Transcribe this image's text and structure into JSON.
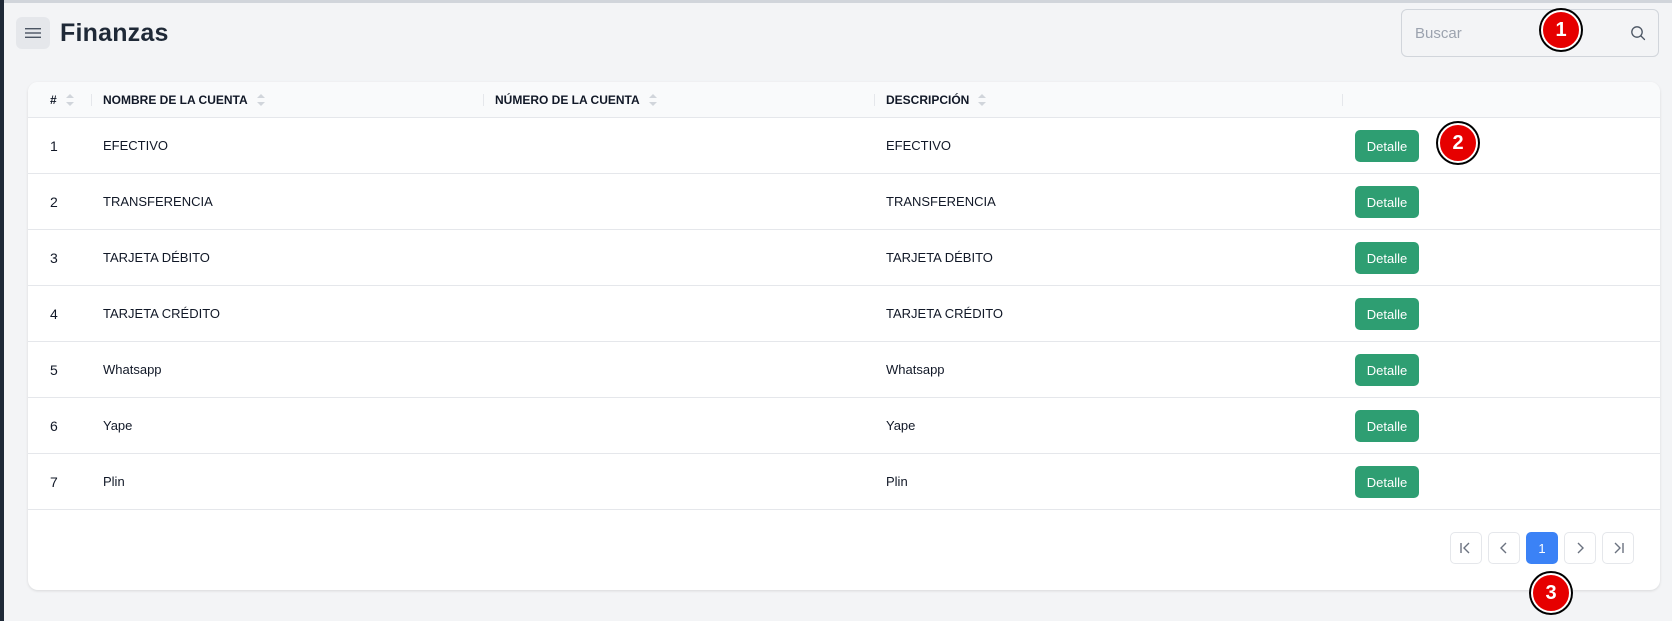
{
  "header": {
    "title": "Finanzas"
  },
  "search": {
    "placeholder": "Buscar"
  },
  "table": {
    "columns": [
      "#",
      "NOMBRE DE LA CUENTA",
      "NÚMERO DE LA CUENTA",
      "DESCRIPCIÓN"
    ],
    "rows": [
      {
        "index": "1",
        "name": "EFECTIVO",
        "number": "",
        "description": "EFECTIVO",
        "action": "Detalle"
      },
      {
        "index": "2",
        "name": "TRANSFERENCIA",
        "number": "",
        "description": "TRANSFERENCIA",
        "action": "Detalle"
      },
      {
        "index": "3",
        "name": "TARJETA DÉBITO",
        "number": "",
        "description": "TARJETA DÉBITO",
        "action": "Detalle"
      },
      {
        "index": "4",
        "name": "TARJETA CRÉDITO",
        "number": "",
        "description": "TARJETA CRÉDITO",
        "action": "Detalle"
      },
      {
        "index": "5",
        "name": "Whatsapp",
        "number": "",
        "description": "Whatsapp",
        "action": "Detalle"
      },
      {
        "index": "6",
        "name": "Yape",
        "number": "",
        "description": "Yape",
        "action": "Detalle"
      },
      {
        "index": "7",
        "name": "Plin",
        "number": "",
        "description": "Plin",
        "action": "Detalle"
      }
    ]
  },
  "pagination": {
    "current_page": "1"
  },
  "markers": [
    "1",
    "2",
    "3"
  ],
  "colors": {
    "accent_green": "#2e9e72",
    "active_blue": "#3b82f6",
    "marker_red": "#e60000"
  },
  "icons": {
    "menu": "hamburger-icon",
    "search": "search-icon",
    "sort": "sort-icon",
    "first": "first-page-icon",
    "prev": "chevron-left-icon",
    "next": "chevron-right-icon",
    "last": "last-page-icon"
  }
}
